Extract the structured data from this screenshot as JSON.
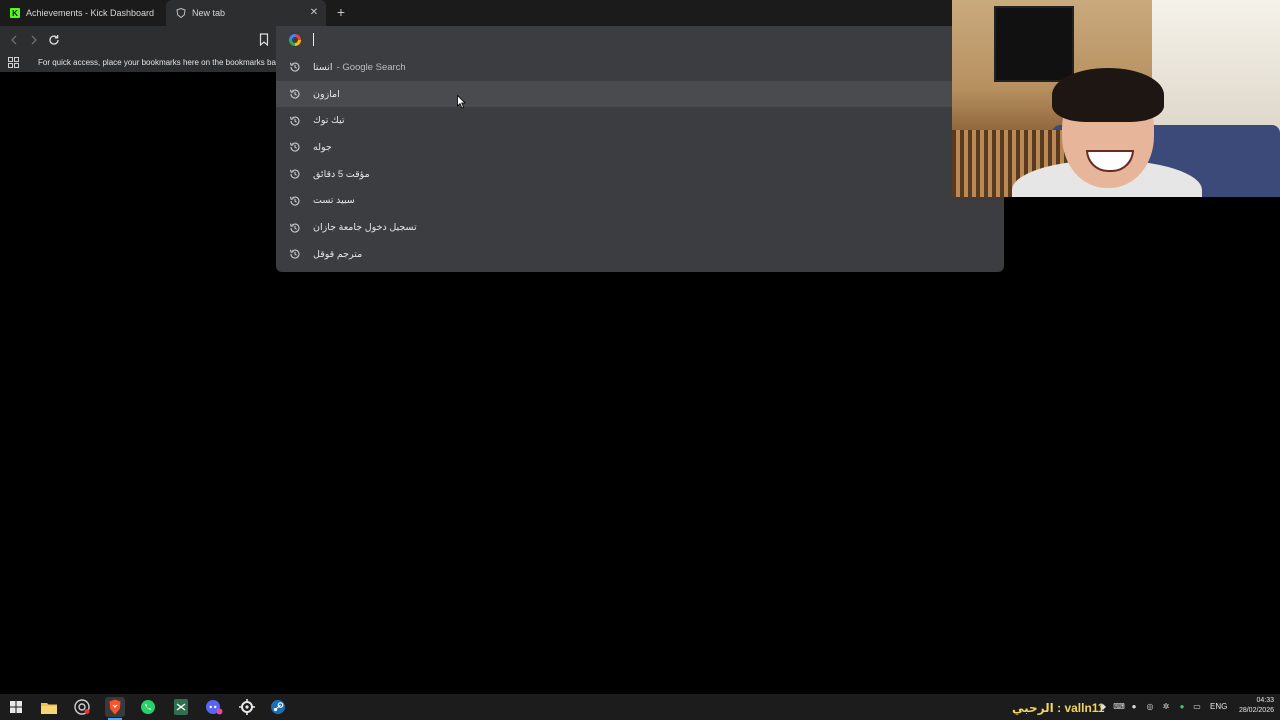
{
  "tabs": [
    {
      "title": "Achievements - Kick Dashboard",
      "favicon": "kick-logo-icon",
      "active": false
    },
    {
      "title": "New tab",
      "favicon": "brave-shield-icon",
      "active": true
    }
  ],
  "toolbar": {
    "omnibox_value": "",
    "search_engine_icon": "google-g-icon"
  },
  "bookmarks_bar": {
    "hint": "For quick access, place your bookmarks here on the bookmarks bar"
  },
  "suggestions": [
    {
      "text": "انستا",
      "sub": " - Google Search",
      "icon": "history-icon"
    },
    {
      "text": "امازون",
      "icon": "history-icon",
      "highlighted": true
    },
    {
      "text": "تيك توك",
      "icon": "history-icon"
    },
    {
      "text": "جوله",
      "icon": "history-icon"
    },
    {
      "text": "مؤقت 5 دقائق",
      "icon": "history-icon"
    },
    {
      "text": "سبيد تست",
      "icon": "history-icon"
    },
    {
      "text": "تسجيل دخول جامعة جازان",
      "icon": "history-icon"
    },
    {
      "text": "مترجم قوقل",
      "icon": "history-icon"
    }
  ],
  "taskbar": {
    "apps": [
      "start-icon",
      "file-explorer-icon",
      "chrome-icon",
      "brave-icon",
      "whatsapp-icon",
      "capcut-icon",
      "discord-icon",
      "steelseries-icon",
      "steam-icon"
    ],
    "overlay_text": "الرحبي : valln11",
    "language": "ENG",
    "time": "04:33",
    "date": "28/02/2026"
  },
  "colors": {
    "accent": "#4fa3ff",
    "kick_green": "#53fc18",
    "overlay_yellow": "#f2d45c"
  }
}
